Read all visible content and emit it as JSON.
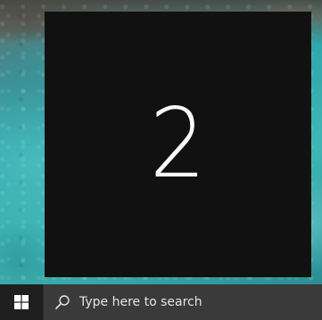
{
  "display_identifier": {
    "number": "2"
  },
  "taskbar": {
    "start_icon": "windows-logo-icon",
    "search_icon": "search-icon",
    "search_placeholder": "Type here to search"
  }
}
